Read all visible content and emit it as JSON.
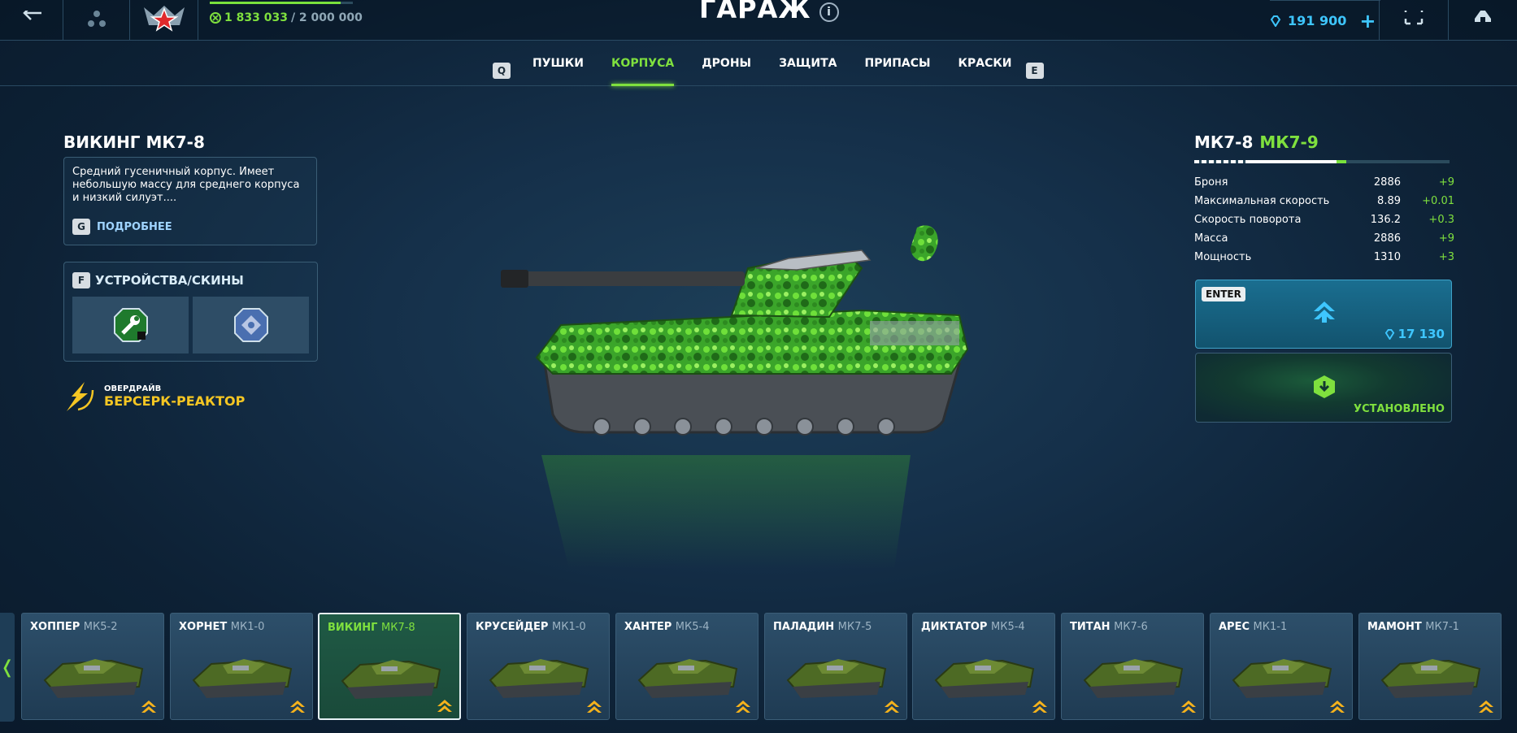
{
  "topbar": {
    "xp_current": "1 833 033",
    "xp_max": "/ 2 000 000",
    "xp_progress": 0.917,
    "title": "ГАРАЖ",
    "info_glyph": "i",
    "crystals": "191 900",
    "add_glyph": "+"
  },
  "tabs": {
    "key_left": "Q",
    "key_right": "E",
    "items": [
      {
        "label": "ПУШКИ",
        "active": false
      },
      {
        "label": "КОРПУСА",
        "active": true
      },
      {
        "label": "ДРОНЫ",
        "active": false
      },
      {
        "label": "ЗАЩИТА",
        "active": false
      },
      {
        "label": "ПРИПАСЫ",
        "active": false
      },
      {
        "label": "КРАСКИ",
        "active": false
      }
    ]
  },
  "item": {
    "name": "ВИКИНГ МК7-8",
    "description": "Средний гусеничный корпус. Имеет небольшую массу для среднего корпуса и низкий силуэт....",
    "more_key": "G",
    "more_label": "ПОДРОБНЕЕ",
    "devices_key": "F",
    "devices_label": "УСТРОЙСТВА/СКИНЫ",
    "overdrive_small": "ОВЕРДРАЙВ",
    "overdrive_name": "БЕРСЕРК-РЕАКТОР"
  },
  "upgrade": {
    "current_mk": "МК7-8",
    "next_mk": "МК7-9",
    "progress": 0.55,
    "stats": [
      {
        "name": "Броня",
        "value": "2886",
        "bonus": "+9"
      },
      {
        "name": "Максимальная скорость",
        "value": "8.89",
        "bonus": "+0.01"
      },
      {
        "name": "Скорость поворота",
        "value": "136.2",
        "bonus": "+0.3"
      },
      {
        "name": "Масса",
        "value": "2886",
        "bonus": "+9"
      },
      {
        "name": "Мощность",
        "value": "1310",
        "bonus": "+3"
      }
    ],
    "enter_key": "ENTER",
    "price": "17 130",
    "installed_label": "УСТАНОВЛЕНО"
  },
  "carousel": {
    "arrow_glyph": "❬",
    "cards": [
      {
        "name": "ХОППЕР",
        "mk": "МК5-2",
        "selected": false
      },
      {
        "name": "ХОРНЕТ",
        "mk": "МК1-0",
        "selected": false
      },
      {
        "name": "ВИКИНГ",
        "mk": "МК7-8",
        "selected": true
      },
      {
        "name": "КРУСЕЙДЕР",
        "mk": "МК1-0",
        "selected": false
      },
      {
        "name": "ХАНТЕР",
        "mk": "МК5-4",
        "selected": false
      },
      {
        "name": "ПАЛАДИН",
        "mk": "МК7-5",
        "selected": false
      },
      {
        "name": "ДИКТАТОР",
        "mk": "МК5-4",
        "selected": false
      },
      {
        "name": "ТИТАН",
        "mk": "МК7-6",
        "selected": false
      },
      {
        "name": "АРЕС",
        "mk": "МК1-1",
        "selected": false
      },
      {
        "name": "МАМОНТ",
        "mk": "МК7-1",
        "selected": false
      }
    ]
  },
  "colors": {
    "accent_green": "#7fe03e",
    "crystal_blue": "#3ec6ff",
    "overdrive_gold": "#f5c623"
  },
  "icons": [
    "back-arrow-icon",
    "network-icon",
    "rank-icon",
    "xp-icon",
    "crystal-icon",
    "fullscreen-icon",
    "home-icon",
    "wrench-icon",
    "skin-icon",
    "overdrive-icon",
    "upgrade-arrow-icon",
    "installed-icon"
  ]
}
